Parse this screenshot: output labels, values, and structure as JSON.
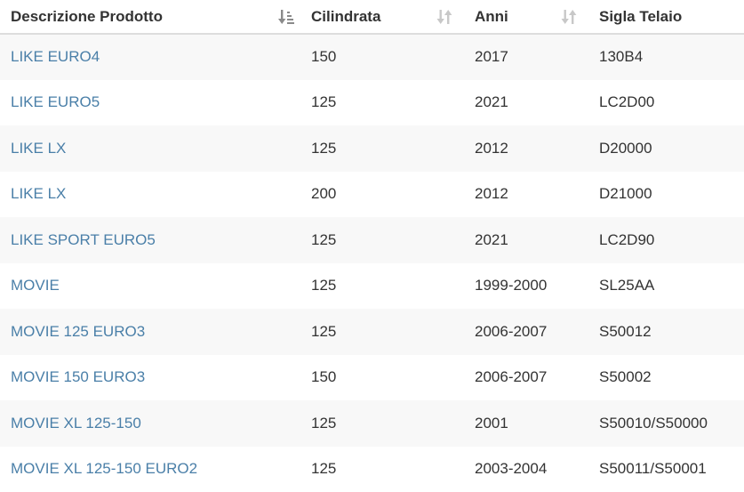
{
  "colors": {
    "link": "#4a7fa8",
    "text": "#333333",
    "row_stripe": "#f8f8f8",
    "sort_active": "#8a8a8a",
    "sort_inactive": "#c8c8c8"
  },
  "table": {
    "headers": [
      {
        "label": "Descrizione Prodotto",
        "sort_icon": "sort-amount-down-icon",
        "sort_state": "active"
      },
      {
        "label": "Cilindrata",
        "sort_icon": "sort-icon",
        "sort_state": "inactive"
      },
      {
        "label": "Anni",
        "sort_icon": "sort-icon",
        "sort_state": "inactive"
      },
      {
        "label": "Sigla Telaio",
        "sort_icon": "",
        "sort_state": "none"
      }
    ],
    "rows": [
      {
        "descrizione": "LIKE EURO4",
        "cilindrata": "150",
        "anni": "2017",
        "sigla": "130B4"
      },
      {
        "descrizione": "LIKE EURO5",
        "cilindrata": "125",
        "anni": "2021",
        "sigla": "LC2D00"
      },
      {
        "descrizione": "LIKE LX",
        "cilindrata": "125",
        "anni": "2012",
        "sigla": "D20000"
      },
      {
        "descrizione": "LIKE LX",
        "cilindrata": "200",
        "anni": "2012",
        "sigla": "D21000"
      },
      {
        "descrizione": "LIKE SPORT EURO5",
        "cilindrata": "125",
        "anni": "2021",
        "sigla": "LC2D90"
      },
      {
        "descrizione": "MOVIE",
        "cilindrata": "125",
        "anni": "1999-2000",
        "sigla": "SL25AA"
      },
      {
        "descrizione": "MOVIE 125 EURO3",
        "cilindrata": "125",
        "anni": "2006-2007",
        "sigla": "S50012"
      },
      {
        "descrizione": "MOVIE 150 EURO3",
        "cilindrata": "150",
        "anni": "2006-2007",
        "sigla": "S50002"
      },
      {
        "descrizione": "MOVIE XL 125-150",
        "cilindrata": "125",
        "anni": "2001",
        "sigla": "S50010/S50000"
      },
      {
        "descrizione": "MOVIE XL 125-150 EURO2",
        "cilindrata": "125",
        "anni": "2003-2004",
        "sigla": "S50011/S50001"
      }
    ]
  }
}
